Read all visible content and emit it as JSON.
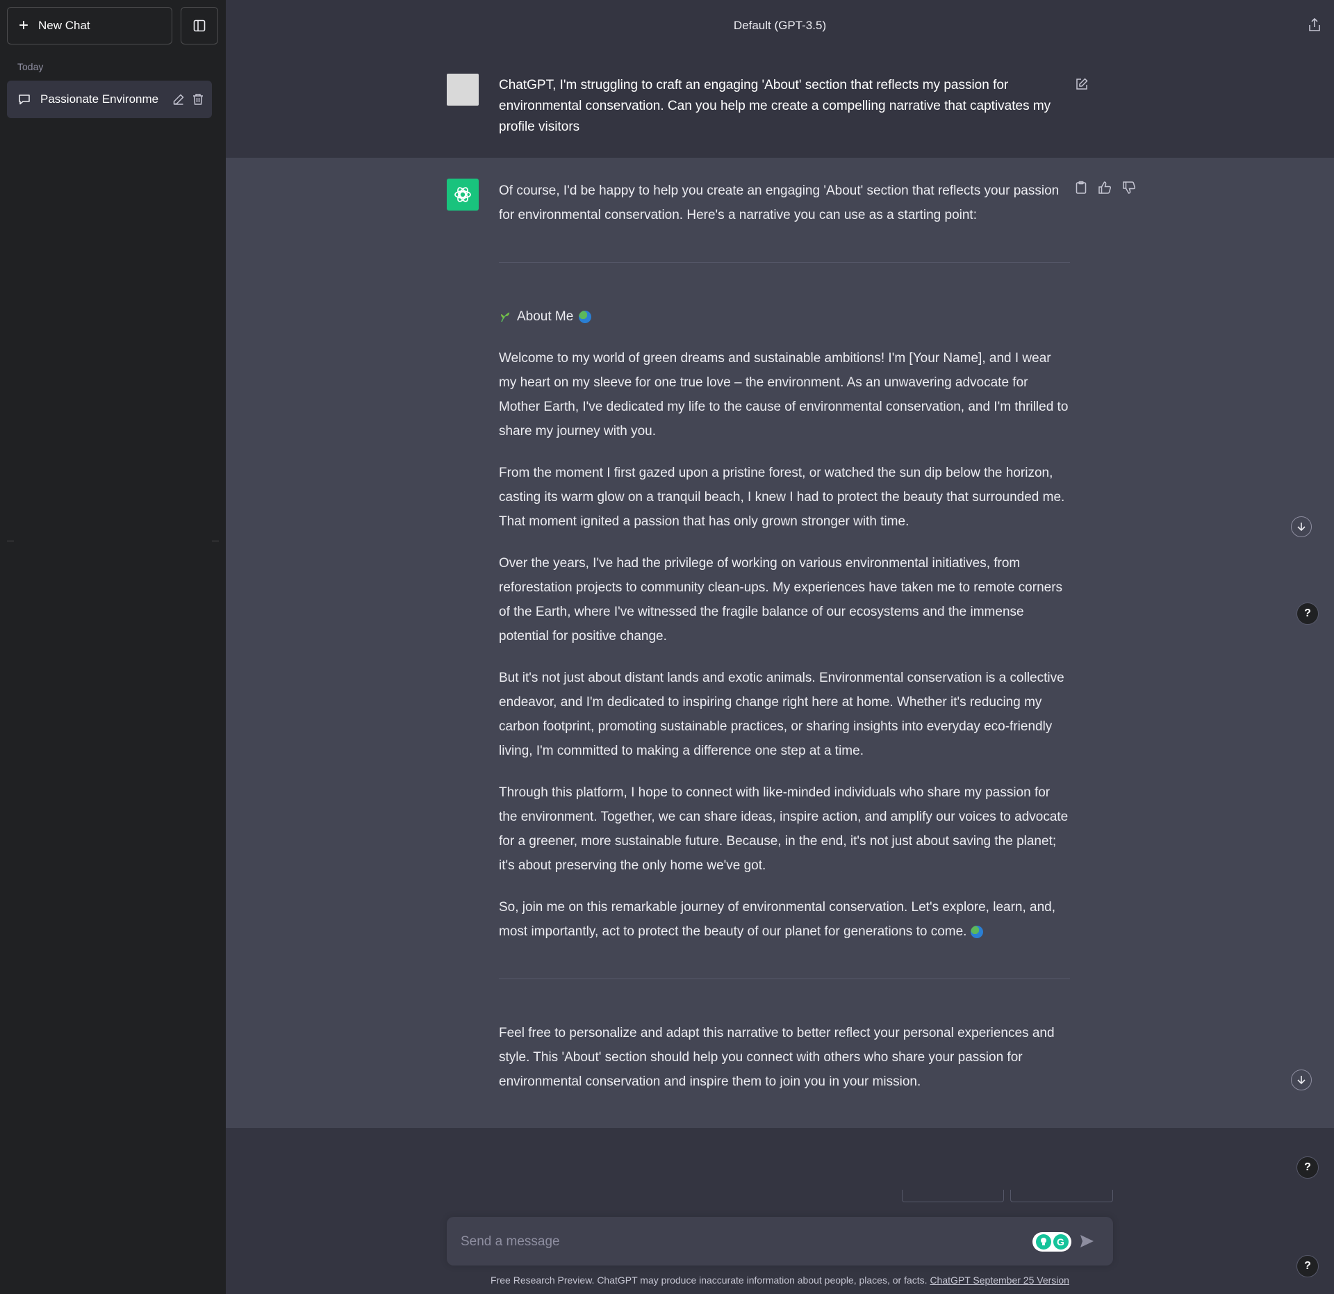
{
  "sidebar": {
    "new_chat_label": "New Chat",
    "section_label": "Today",
    "chats": [
      {
        "label": "Passionate Environme"
      }
    ]
  },
  "header": {
    "model": "Default (GPT-3.5)"
  },
  "user_message": {
    "text": "ChatGPT, I'm struggling to craft an engaging 'About' section that reflects my passion for environmental conservation. Can you help me create a compelling narrative that captivates my profile visitors"
  },
  "assistant_message": {
    "intro": "Of course, I'd be happy to help you create an engaging 'About' section that reflects your passion for environmental conservation. Here's a narrative you can use as a starting point:",
    "heading": "About Me",
    "paragraphs": [
      "Welcome to my world of green dreams and sustainable ambitions! I'm [Your Name], and I wear my heart on my sleeve for one true love – the environment. As an unwavering advocate for Mother Earth, I've dedicated my life to the cause of environmental conservation, and I'm thrilled to share my journey with you.",
      "From the moment I first gazed upon a pristine forest, or watched the sun dip below the horizon, casting its warm glow on a tranquil beach, I knew I had to protect the beauty that surrounded me. That moment ignited a passion that has only grown stronger with time.",
      "Over the years, I've had the privilege of working on various environmental initiatives, from reforestation projects to community clean-ups. My experiences have taken me to remote corners of the Earth, where I've witnessed the fragile balance of our ecosystems and the immense potential for positive change.",
      "But it's not just about distant lands and exotic animals. Environmental conservation is a collective endeavor, and I'm dedicated to inspiring change right here at home. Whether it's reducing my carbon footprint, promoting sustainable practices, or sharing insights into everyday eco-friendly living, I'm committed to making a difference one step at a time.",
      "Through this platform, I hope to connect with like-minded individuals who share my passion for the environment. Together, we can share ideas, inspire action, and amplify our voices to advocate for a greener, more sustainable future. Because, in the end, it's not just about saving the planet; it's about preserving the only home we've got.",
      "So, join me on this remarkable journey of environmental conservation. Let's explore, learn, and, most importantly, act to protect the beauty of our planet for generations to come."
    ],
    "closing": "Feel free to personalize and adapt this narrative to better reflect your personal experiences and style. This 'About' section should help you connect with others who share your passion for environmental conservation and inspire them to join you in your mission."
  },
  "composer": {
    "placeholder": "Send a message",
    "grammarly_label": "G"
  },
  "footer": {
    "text": "Free Research Preview. ChatGPT may produce inaccurate information about people, places, or facts.",
    "link": "ChatGPT September 25 Version"
  },
  "help_label": "?",
  "icons": {
    "plus": "plus-icon",
    "sidebar_toggle": "sidebar-toggle-icon",
    "chat": "chat-bubble-icon",
    "edit": "pencil-icon",
    "trash": "trash-icon",
    "share": "share-icon",
    "copy": "clipboard-icon",
    "thumbs_up": "thumbs-up-icon",
    "thumbs_down": "thumbs-down-icon",
    "arrow_down": "arrow-down-icon",
    "send": "send-icon"
  },
  "colors": {
    "sidebar_bg": "#202123",
    "main_bg": "#343541",
    "assistant_bg": "#444654",
    "gpt_avatar": "#19c37d"
  }
}
